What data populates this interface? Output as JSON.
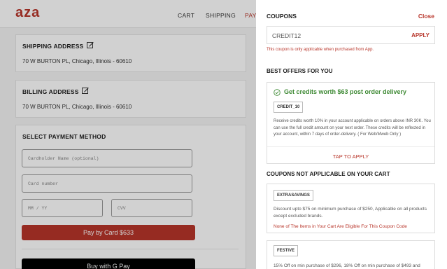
{
  "header": {
    "logo": "aza",
    "nav": {
      "cart": "CART",
      "shipping": "SHIPPING",
      "pay": "PAY"
    }
  },
  "shipping": {
    "title": "SHIPPING ADDRESS",
    "address": "70 W BURTON PL, Chicago, Illinois - 60610"
  },
  "billing": {
    "title": "BILLING ADDRESS",
    "address": "70 W BURTON PL, Chicago, Illinois - 60610"
  },
  "payment": {
    "title": "SELECT PAYMENT METHOD",
    "cardholder_placeholder": "Cardholder Name (optional)",
    "card_number_placeholder": "Card number",
    "expiry_placeholder": "MM / YY",
    "cvv_placeholder": "CVV",
    "pay_button": "Pay by Card $633",
    "gpay_button": "Buy with G Pay"
  },
  "coupons": {
    "title": "COUPONS",
    "close": "Close",
    "input_value": "CREDIT12",
    "apply": "APPLY",
    "error": "This coupon is only applicable when purchased from App.",
    "best_offers_title": "BEST OFFERS FOR YOU",
    "best_offer": {
      "headline": "Get credits worth $63 post order delivery",
      "code": "CREDIT_10",
      "description": "Receive credits worth 10% in your account applicable on orders above INR 30K. You can use the full credit amount on your next order. These credits will be reflected in your account, within 7 days of order-delivery. ( For Web/Mweb Only )",
      "action": "TAP TO APPLY"
    },
    "not_applicable_title": "COUPONS NOT APPLICABLE ON YOUR CART",
    "not_applicable": [
      {
        "code": "EXTRASAVINGS",
        "description": "Discount upto $75 on minimum purchase of $250, Applicable on all products except excluded brands.",
        "reason": "None of The Items in Your Cart Are Eligible For This Coupon Code"
      },
      {
        "code": "FESTIVE",
        "description": "15% Off on min purchase of $296, 18% Off on min purchase of $493 and"
      }
    ]
  },
  "colors": {
    "brand": "#b8352a",
    "success": "#3f8a35"
  }
}
